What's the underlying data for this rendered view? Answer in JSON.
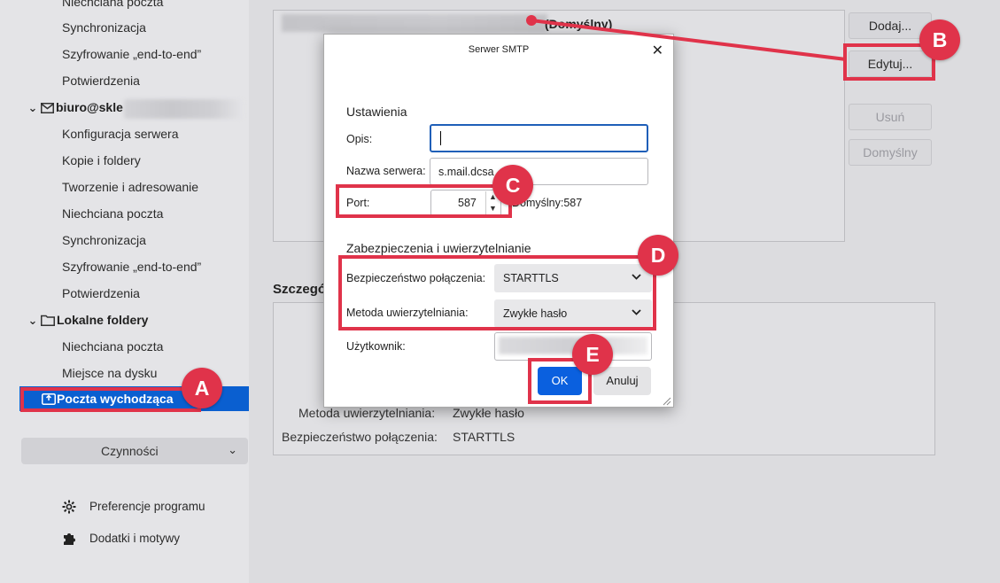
{
  "sidebar": {
    "top_items": [
      "Niechciana poczta",
      "Synchronizacja",
      "Szyfrowanie „end-to-end”",
      "Potwierdzenia"
    ],
    "account": {
      "name": "biuro@skle",
      "items": [
        "Konfiguracja serwera",
        "Kopie i foldery",
        "Tworzenie i adresowanie",
        "Niechciana poczta",
        "Synchronizacja",
        "Szyfrowanie „end-to-end”",
        "Potwierdzenia"
      ]
    },
    "local_folders": {
      "name": "Lokalne foldery",
      "items": [
        "Niechciana poczta",
        "Miejsce na dysku"
      ]
    },
    "outbox_label": "Poczta wychodząca",
    "actions_label": "Czynności",
    "footer": {
      "preferences": "Preferencje programu",
      "addons": "Dodatki i motywy"
    }
  },
  "main": {
    "list_default_tag": "(Domyślny)",
    "buttons": {
      "add": "Dodaj...",
      "edit": "Edytuj...",
      "remove": "Usuń",
      "default": "Domyślny"
    },
    "details_title": "Szczegó",
    "details": {
      "auth_method_label": "Metoda uwierzytelniania:",
      "auth_method_value": "Zwykłe hasło",
      "security_label": "Bezpieczeństwo połączenia:",
      "security_value": "STARTTLS"
    }
  },
  "dialog": {
    "title": "Serwer SMTP",
    "close": "✕",
    "settings_title": "Ustawienia",
    "description_label": "Opis:",
    "description_value": "",
    "server_label": "Nazwa serwera:",
    "server_value": "s.mail.dcsa",
    "port_label": "Port:",
    "port_value": "587",
    "port_default": "Domyślny:587",
    "security_section": "Zabezpieczenia i uwierzytelnianie",
    "conn_security_label": "Bezpieczeństwo połączenia:",
    "conn_security_value": "STARTTLS",
    "auth_label": "Metoda uwierzytelniania:",
    "auth_value": "Zwykłe hasło",
    "user_label": "Użytkownik:",
    "ok": "OK",
    "cancel": "Anuluj"
  },
  "annotations": {
    "A": "A",
    "B": "B",
    "C": "C",
    "D": "D",
    "E": "E",
    "color": "#e0334a"
  },
  "colors": {
    "accent": "#0a5fd0",
    "ok_button": "#0a60df"
  }
}
